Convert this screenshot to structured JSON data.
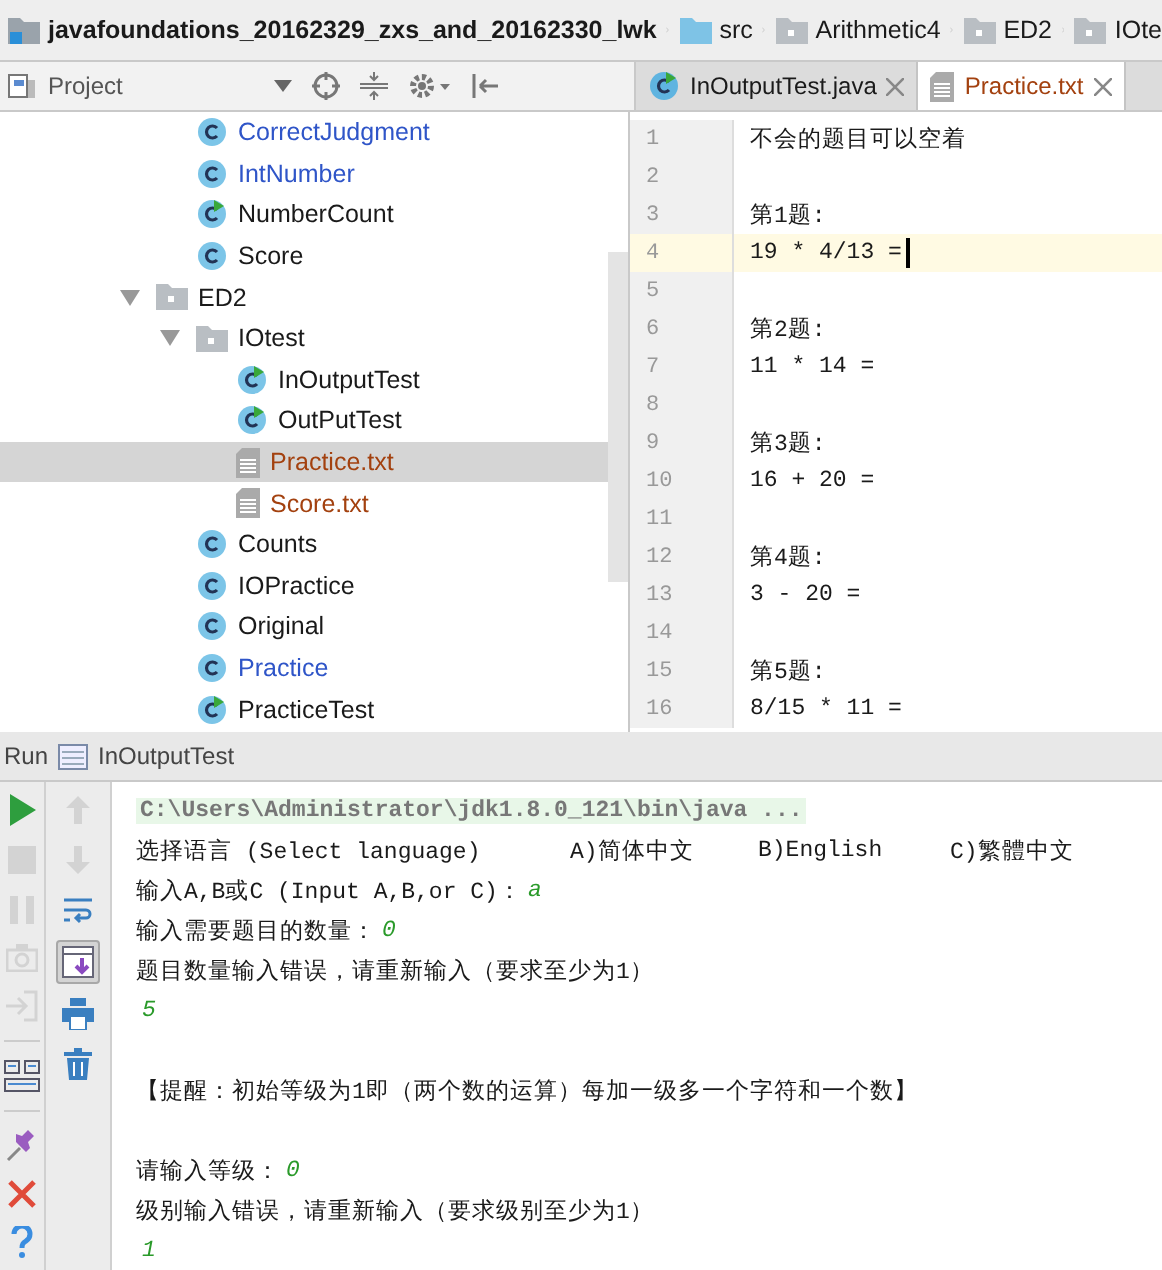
{
  "breadcrumb": [
    {
      "kind": "project",
      "label": "javafoundations_20162329_zxs_and_20162330_lwk"
    },
    {
      "kind": "source",
      "label": "src"
    },
    {
      "kind": "package",
      "label": "Arithmetic4"
    },
    {
      "kind": "package",
      "label": "ED2"
    },
    {
      "kind": "package",
      "label": "IOte"
    }
  ],
  "project_panel": {
    "title": "Project"
  },
  "editor_tabs": [
    {
      "label": "InOutputTest.java",
      "kind": "runnable-class",
      "selected": false
    },
    {
      "label": "Practice.txt",
      "kind": "text-file",
      "selected": true
    }
  ],
  "tree": [
    {
      "kind": "group",
      "children": [
        {
          "kind": "class",
          "label": "CorrectJudgment",
          "color": "#2f55c8",
          "selected": false
        },
        {
          "kind": "class",
          "label": "IntNumber",
          "color": "#2f55c8",
          "selected": false
        },
        {
          "kind": "runnable-class",
          "label": "NumberCount",
          "color": "#1a1a1a",
          "selected": false
        },
        {
          "kind": "class",
          "label": "Score",
          "color": "#1a1a1a",
          "selected": false
        }
      ]
    },
    {
      "kind": "folder",
      "label": "ED2",
      "color": "#1a1a1a",
      "selected": false,
      "expanded": true,
      "children": [
        {
          "kind": "folder",
          "label": "IOtest",
          "color": "#1a1a1a",
          "selected": false,
          "expanded": true,
          "children": [
            {
              "kind": "runnable-class",
              "label": "InOutputTest",
              "color": "#1a1a1a",
              "selected": false
            },
            {
              "kind": "runnable-class",
              "label": "OutPutTest",
              "color": "#1a1a1a",
              "selected": false
            },
            {
              "kind": "text-file",
              "label": "Practice.txt",
              "color": "#a3410f",
              "selected": true
            },
            {
              "kind": "text-file",
              "label": "Score.txt",
              "color": "#a3410f",
              "selected": false
            }
          ]
        },
        {
          "kind": "class",
          "label": "Counts",
          "color": "#1a1a1a",
          "selected": false
        },
        {
          "kind": "class",
          "label": "IOPractice",
          "color": "#1a1a1a",
          "selected": false
        },
        {
          "kind": "class",
          "label": "Original",
          "color": "#1a1a1a",
          "selected": false
        },
        {
          "kind": "class",
          "label": "Practice",
          "color": "#2f55c8",
          "selected": false
        },
        {
          "kind": "runnable-class",
          "label": "PracticeTest",
          "color": "#1a1a1a",
          "selected": false
        }
      ]
    }
  ],
  "editor_lines": [
    {
      "number": "1",
      "text": "不会的题目可以空着",
      "current": false
    },
    {
      "number": "2",
      "current": false
    },
    {
      "number": "3",
      "text": "第1题:",
      "current": false
    },
    {
      "number": "4",
      "text": "19 * 4/13 =",
      "current": true
    },
    {
      "number": "5",
      "current": false
    },
    {
      "number": "6",
      "text": "第2题:",
      "current": false
    },
    {
      "number": "7",
      "text": "11 * 14 =",
      "current": false
    },
    {
      "number": "8",
      "current": false
    },
    {
      "number": "9",
      "text": "第3题:",
      "current": false
    },
    {
      "number": "10",
      "text": "16 + 20 =",
      "current": false
    },
    {
      "number": "11",
      "current": false
    },
    {
      "number": "12",
      "text": "第4题:",
      "current": false
    },
    {
      "number": "13",
      "text": "3 - 20 =",
      "current": false
    },
    {
      "number": "14",
      "current": false
    },
    {
      "number": "15",
      "text": "第5题:",
      "current": false
    },
    {
      "number": "16",
      "text": "8/15 * 11 =",
      "current": false
    }
  ],
  "run_panel": {
    "label": "Run",
    "config": "InOutputTest"
  },
  "run_tools": [
    {
      "kind": "run",
      "disabled": false
    },
    {
      "kind": "stop",
      "disabled": true
    },
    {
      "kind": "pause",
      "disabled": true
    },
    {
      "kind": "camera",
      "disabled": true
    },
    {
      "kind": "exit",
      "disabled": true
    },
    {
      "kind": "layout",
      "disabled": false
    },
    {
      "kind": "pin",
      "disabled": false
    },
    {
      "kind": "close",
      "disabled": false
    },
    {
      "kind": "help",
      "disabled": false
    }
  ],
  "console_tools": [
    {
      "kind": "up",
      "disabled": true,
      "on": false
    },
    {
      "kind": "down",
      "disabled": true,
      "on": false
    },
    {
      "kind": "wrap",
      "disabled": false,
      "on": false
    },
    {
      "kind": "scroll-end",
      "disabled": false,
      "on": true
    },
    {
      "kind": "print",
      "disabled": false,
      "on": false
    },
    {
      "kind": "trash",
      "disabled": false,
      "on": false
    }
  ],
  "console": [
    {
      "kind": "command",
      "parts": [
        {
          "kind": "output",
          "text": "C:\\Users\\Administrator\\jdk1.8.0_121\\bin\\java ..."
        }
      ]
    },
    {
      "kind": "columns",
      "parts": [
        {
          "kind": "output",
          "text": "选择语言 (Select language)"
        },
        {
          "kind": "output",
          "text": "A)简体中文"
        },
        {
          "kind": "output",
          "text": "B)English"
        },
        {
          "kind": "output",
          "text": "C)繁體中文"
        }
      ]
    },
    {
      "kind": "plain",
      "parts": [
        {
          "kind": "output",
          "text": "输入A,B或C (Input A,B,or C)："
        },
        {
          "kind": "input",
          "text": "a"
        }
      ]
    },
    {
      "kind": "plain",
      "parts": [
        {
          "kind": "output",
          "text": "输入需要题目的数量："
        },
        {
          "kind": "input",
          "text": "0"
        }
      ]
    },
    {
      "kind": "plain",
      "parts": [
        {
          "kind": "output",
          "text": "题目数量输入错误，请重新输入（要求至少为1）"
        }
      ]
    },
    {
      "kind": "plain",
      "parts": [
        {
          "kind": "input",
          "text": "5"
        }
      ]
    },
    {
      "kind": "blank"
    },
    {
      "kind": "plain",
      "parts": [
        {
          "kind": "output",
          "text": "【提醒：初始等级为1即（两个数的运算）每加一级多一个字符和一个数】"
        }
      ]
    },
    {
      "kind": "blank"
    },
    {
      "kind": "plain",
      "parts": [
        {
          "kind": "output",
          "text": "请输入等级："
        },
        {
          "kind": "input",
          "text": "0"
        }
      ]
    },
    {
      "kind": "plain",
      "parts": [
        {
          "kind": "output",
          "text": "级别输入错误，请重新输入（要求级别至少为1）"
        }
      ]
    },
    {
      "kind": "plain",
      "parts": [
        {
          "kind": "input",
          "text": "1"
        }
      ]
    }
  ]
}
